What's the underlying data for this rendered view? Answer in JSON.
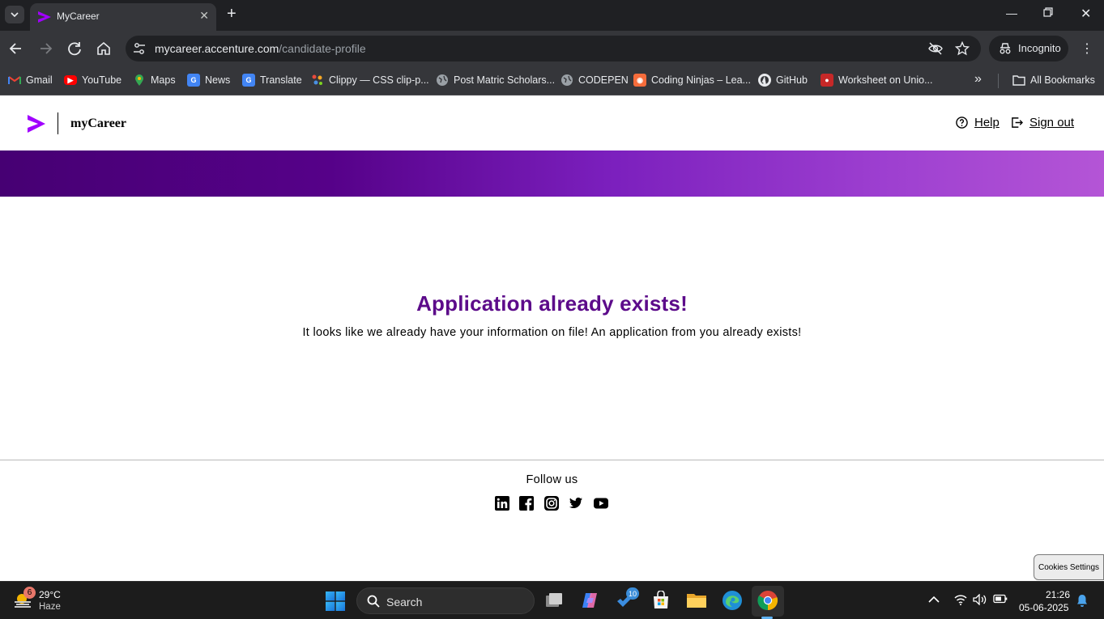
{
  "browser": {
    "tab_title": "MyCareer",
    "url_host": "mycareer.accenture.com",
    "url_path": "/candidate-profile",
    "incognito_label": "Incognito",
    "bookmarks": [
      {
        "label": "Gmail",
        "icon": "gmail-icon"
      },
      {
        "label": "YouTube",
        "icon": "youtube-icon"
      },
      {
        "label": "Maps",
        "icon": "maps-icon"
      },
      {
        "label": "News",
        "icon": "news-icon"
      },
      {
        "label": "Translate",
        "icon": "translate-icon"
      },
      {
        "label": "Clippy — CSS clip-p...",
        "icon": "clippy-icon"
      },
      {
        "label": "Post Matric Scholars...",
        "icon": "globe-icon"
      },
      {
        "label": "CODEPEN",
        "icon": "globe-icon"
      },
      {
        "label": "Coding Ninjas – Lea...",
        "icon": "coding-ninjas-icon"
      },
      {
        "label": "GitHub",
        "icon": "github-icon"
      },
      {
        "label": "Worksheet on Unio...",
        "icon": "worksheet-icon"
      }
    ],
    "more_bookmarks": "»",
    "all_bookmarks_label": "All Bookmarks"
  },
  "site": {
    "brand": "myCareer",
    "help_label": "Help",
    "signout_label": "Sign out",
    "brand_color": "#A100FF"
  },
  "main": {
    "title": "Application already exists!",
    "message": "It looks like we already have your information on file! An application from you already exists!"
  },
  "footer": {
    "follow_label": "Follow us",
    "socials": [
      "linkedin-icon",
      "facebook-icon",
      "instagram-icon",
      "twitter-icon",
      "youtube-icon"
    ]
  },
  "cookies_label": "Cookies Settings",
  "taskbar": {
    "weather_badge": "6",
    "temperature": "29°C",
    "condition": "Haze",
    "search_label": "Search",
    "todo_badge": "10",
    "time": "21:26",
    "date": "05-06-2025"
  }
}
